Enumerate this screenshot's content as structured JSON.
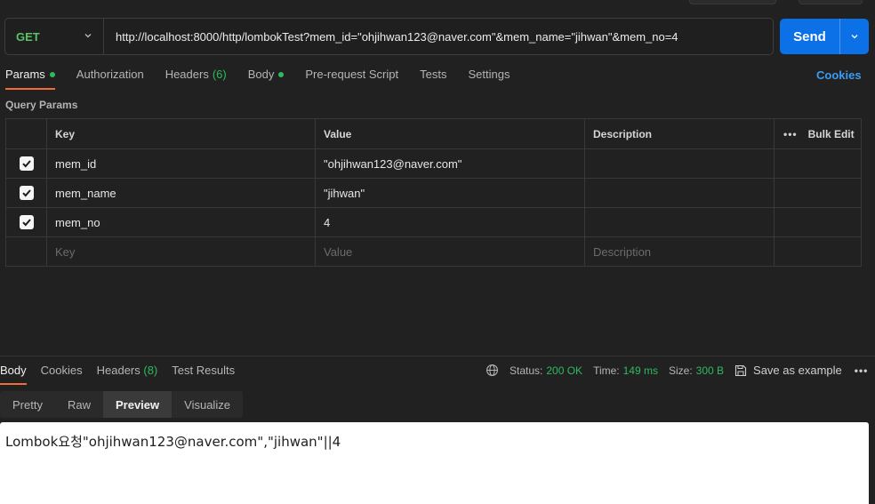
{
  "request": {
    "method": "GET",
    "url": "http://localhost:8000/http/lombokTest?mem_id=\"ohjihwan123@naver.com\"&mem_name=\"jihwan\"&mem_no=4",
    "send_label": "Send"
  },
  "request_tabs": [
    {
      "label": "Params",
      "active": true,
      "dot": true
    },
    {
      "label": "Authorization"
    },
    {
      "label": "Headers",
      "count": "(6)"
    },
    {
      "label": "Body",
      "dot": true
    },
    {
      "label": "Pre-request Script"
    },
    {
      "label": "Tests"
    },
    {
      "label": "Settings"
    }
  ],
  "cookies_link": "Cookies",
  "query_params": {
    "title": "Query Params",
    "headers": {
      "key": "Key",
      "value": "Value",
      "description": "Description",
      "bulk_edit": "Bulk Edit"
    },
    "rows": [
      {
        "checked": true,
        "key": "mem_id",
        "value": "\"ohjihwan123@naver.com\"",
        "description": ""
      },
      {
        "checked": true,
        "key": "mem_name",
        "value": "\"jihwan\"",
        "description": ""
      },
      {
        "checked": true,
        "key": "mem_no",
        "value": "4",
        "description": ""
      }
    ],
    "placeholders": {
      "key": "Key",
      "value": "Value",
      "description": "Description"
    }
  },
  "response": {
    "tabs": [
      {
        "label": "Body",
        "active": true
      },
      {
        "label": "Cookies"
      },
      {
        "label": "Headers",
        "count": "(8)"
      },
      {
        "label": "Test Results"
      }
    ],
    "status_label": "Status:",
    "status_value": "200 OK",
    "time_label": "Time:",
    "time_value": "149 ms",
    "size_label": "Size:",
    "size_value": "300 B",
    "save_label": "Save as example",
    "view_tabs": [
      {
        "label": "Pretty"
      },
      {
        "label": "Raw"
      },
      {
        "label": "Preview",
        "active": true
      },
      {
        "label": "Visualize"
      }
    ],
    "body": "Lombok요청\"ohjihwan123@naver.com\",\"jihwan\"||4"
  },
  "colors": {
    "accent": "#0c71e6",
    "method": "#59c36a",
    "status_ok": "#2dbb5d",
    "active_tab": "#f26b3a",
    "link": "#3b9cf5"
  }
}
